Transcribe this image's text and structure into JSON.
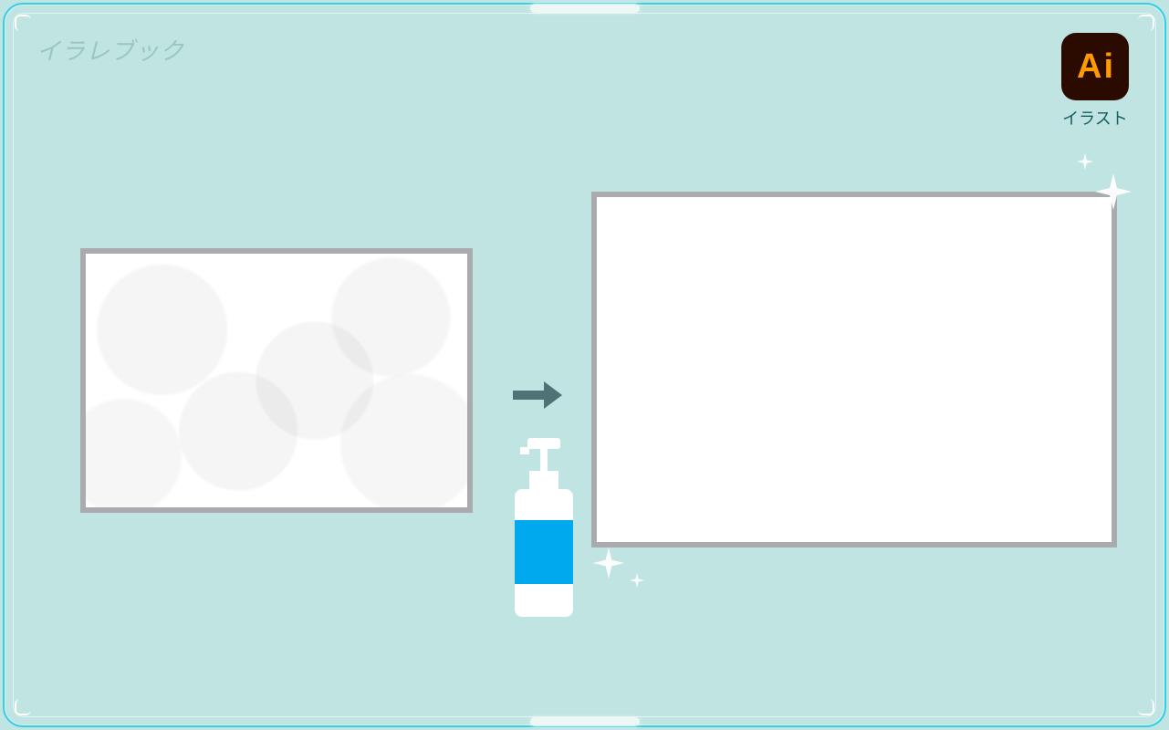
{
  "watermark_text": "イラレブック",
  "badge": {
    "letters_a": "A",
    "letters_i": "i",
    "label": "イラスト"
  },
  "illustration": {
    "left_card_state": "dirty",
    "right_card_state": "clean",
    "concept": "before-after cleaning with soap dispenser",
    "bottle_label_color": "#00a9ee",
    "card_border_color": "#a9abae",
    "arrow_color": "#4e7276",
    "background_color": "#bfe4e1",
    "frame_color": "#2fd0e6"
  }
}
